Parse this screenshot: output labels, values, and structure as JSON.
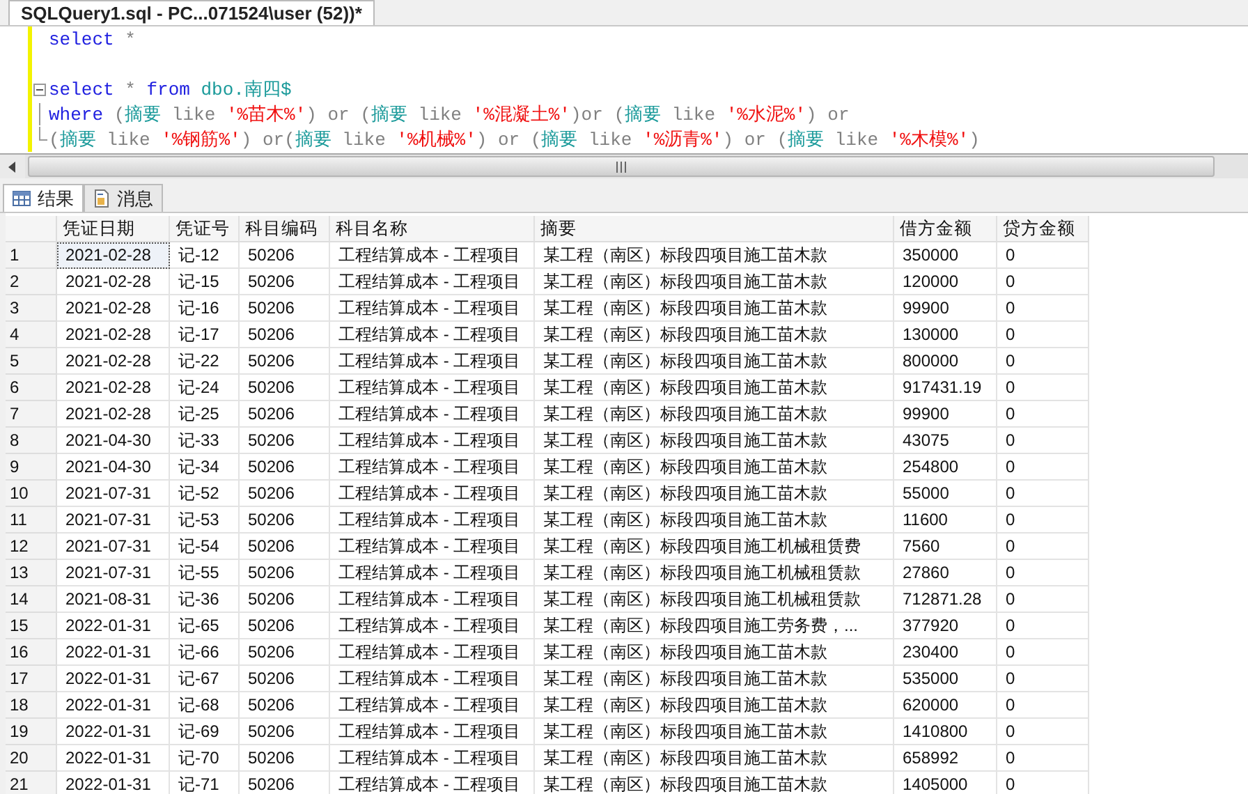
{
  "document_tab": {
    "title": "SQLQuery1.sql - PC...071524\\user (52))*",
    "selected": true
  },
  "editor": {
    "lines": [
      {
        "kind": "code",
        "tokens": [
          {
            "kind": "kw",
            "text": "select"
          },
          {
            "kind": "op",
            "text": " *"
          }
        ]
      },
      {
        "kind": "blank"
      },
      {
        "kind": "fold-start",
        "tokens": [
          {
            "kind": "kw",
            "text": "select"
          },
          {
            "kind": "op",
            "text": " * "
          },
          {
            "kind": "kw",
            "text": "from "
          },
          {
            "kind": "id",
            "text": "dbo.南四$"
          }
        ]
      },
      {
        "kind": "fold-mid",
        "tokens": [
          {
            "kind": "kw",
            "text": "where"
          },
          {
            "kind": "op",
            "text": " ("
          },
          {
            "kind": "id",
            "text": "摘要"
          },
          {
            "kind": "op",
            "text": " like "
          },
          {
            "kind": "str",
            "text": "'%苗木%'"
          },
          {
            "kind": "op",
            "text": ") or ("
          },
          {
            "kind": "id",
            "text": "摘要"
          },
          {
            "kind": "op",
            "text": " like "
          },
          {
            "kind": "str",
            "text": "'%混凝土%'"
          },
          {
            "kind": "op",
            "text": ")or ("
          },
          {
            "kind": "id",
            "text": "摘要"
          },
          {
            "kind": "op",
            "text": " like "
          },
          {
            "kind": "str",
            "text": "'%水泥%'"
          },
          {
            "kind": "op",
            "text": ") or"
          }
        ]
      },
      {
        "kind": "fold-end",
        "tokens": [
          {
            "kind": "op",
            "text": "("
          },
          {
            "kind": "id",
            "text": "摘要"
          },
          {
            "kind": "op",
            "text": " like "
          },
          {
            "kind": "str",
            "text": "'%钢筋%'"
          },
          {
            "kind": "op",
            "text": ") or("
          },
          {
            "kind": "id",
            "text": "摘要"
          },
          {
            "kind": "op",
            "text": " like "
          },
          {
            "kind": "str",
            "text": "'%机械%'"
          },
          {
            "kind": "op",
            "text": ") or ("
          },
          {
            "kind": "id",
            "text": "摘要"
          },
          {
            "kind": "op",
            "text": " like "
          },
          {
            "kind": "str",
            "text": "'%沥青%'"
          },
          {
            "kind": "op",
            "text": ") or ("
          },
          {
            "kind": "id",
            "text": "摘要"
          },
          {
            "kind": "op",
            "text": " like "
          },
          {
            "kind": "str",
            "text": "'%木模%'"
          },
          {
            "kind": "op",
            "text": ")"
          }
        ]
      }
    ]
  },
  "result_tabs": [
    {
      "label": "结果",
      "kind": "grid",
      "selected": true
    },
    {
      "label": "消息",
      "kind": "messages",
      "selected": false
    }
  ],
  "table": {
    "columns": [
      "凭证日期",
      "凭证号",
      "科目编码",
      "科目名称",
      "摘要",
      "借方金额",
      "贷方金额"
    ],
    "rows": [
      {
        "number": "1",
        "focused": true,
        "cells": [
          "2021-02-28",
          "记-12",
          "50206",
          "工程结算成本 - 工程项目",
          "某工程（南区）标段四项目施工苗木款",
          "350000",
          "0"
        ]
      },
      {
        "number": "2",
        "focused": false,
        "cells": [
          "2021-02-28",
          "记-15",
          "50206",
          "工程结算成本 - 工程项目",
          "某工程（南区）标段四项目施工苗木款",
          "120000",
          "0"
        ]
      },
      {
        "number": "3",
        "focused": false,
        "cells": [
          "2021-02-28",
          "记-16",
          "50206",
          "工程结算成本 - 工程项目",
          "某工程（南区）标段四项目施工苗木款",
          "99900",
          "0"
        ]
      },
      {
        "number": "4",
        "focused": false,
        "cells": [
          "2021-02-28",
          "记-17",
          "50206",
          "工程结算成本 - 工程项目",
          "某工程（南区）标段四项目施工苗木款",
          "130000",
          "0"
        ]
      },
      {
        "number": "5",
        "focused": false,
        "cells": [
          "2021-02-28",
          "记-22",
          "50206",
          "工程结算成本 - 工程项目",
          "某工程（南区）标段四项目施工苗木款",
          "800000",
          "0"
        ]
      },
      {
        "number": "6",
        "focused": false,
        "cells": [
          "2021-02-28",
          "记-24",
          "50206",
          "工程结算成本 - 工程项目",
          "某工程（南区）标段四项目施工苗木款",
          "917431.19",
          "0"
        ]
      },
      {
        "number": "7",
        "focused": false,
        "cells": [
          "2021-02-28",
          "记-25",
          "50206",
          "工程结算成本 - 工程项目",
          "某工程（南区）标段四项目施工苗木款",
          "99900",
          "0"
        ]
      },
      {
        "number": "8",
        "focused": false,
        "cells": [
          "2021-04-30",
          "记-33",
          "50206",
          "工程结算成本 - 工程项目",
          "某工程（南区）标段四项目施工苗木款",
          "43075",
          "0"
        ]
      },
      {
        "number": "9",
        "focused": false,
        "cells": [
          "2021-04-30",
          "记-34",
          "50206",
          "工程结算成本 - 工程项目",
          "某工程（南区）标段四项目施工苗木款",
          "254800",
          "0"
        ]
      },
      {
        "number": "10",
        "focused": false,
        "cells": [
          "2021-07-31",
          "记-52",
          "50206",
          "工程结算成本 - 工程项目",
          "某工程（南区）标段四项目施工苗木款",
          "55000",
          "0"
        ]
      },
      {
        "number": "11",
        "focused": false,
        "cells": [
          "2021-07-31",
          "记-53",
          "50206",
          "工程结算成本 - 工程项目",
          "某工程（南区）标段四项目施工苗木款",
          "11600",
          "0"
        ]
      },
      {
        "number": "12",
        "focused": false,
        "cells": [
          "2021-07-31",
          "记-54",
          "50206",
          "工程结算成本 - 工程项目",
          "某工程（南区）标段四项目施工机械租赁费",
          "7560",
          "0"
        ]
      },
      {
        "number": "13",
        "focused": false,
        "cells": [
          "2021-07-31",
          "记-55",
          "50206",
          "工程结算成本 - 工程项目",
          "某工程（南区）标段四项目施工机械租赁款",
          "27860",
          "0"
        ]
      },
      {
        "number": "14",
        "focused": false,
        "cells": [
          "2021-08-31",
          "记-36",
          "50206",
          "工程结算成本 - 工程项目",
          "某工程（南区）标段四项目施工机械租赁款",
          "712871.28",
          "0"
        ]
      },
      {
        "number": "15",
        "focused": false,
        "cells": [
          "2022-01-31",
          "记-65",
          "50206",
          "工程结算成本 - 工程项目",
          "某工程（南区）标段四项目施工劳务费，...",
          "377920",
          "0"
        ]
      },
      {
        "number": "16",
        "focused": false,
        "cells": [
          "2022-01-31",
          "记-66",
          "50206",
          "工程结算成本 - 工程项目",
          "某工程（南区）标段四项目施工苗木款",
          "230400",
          "0"
        ]
      },
      {
        "number": "17",
        "focused": false,
        "cells": [
          "2022-01-31",
          "记-67",
          "50206",
          "工程结算成本 - 工程项目",
          "某工程（南区）标段四项目施工苗木款",
          "535000",
          "0"
        ]
      },
      {
        "number": "18",
        "focused": false,
        "cells": [
          "2022-01-31",
          "记-68",
          "50206",
          "工程结算成本 - 工程项目",
          "某工程（南区）标段四项目施工苗木款",
          "620000",
          "0"
        ]
      },
      {
        "number": "19",
        "focused": false,
        "cells": [
          "2022-01-31",
          "记-69",
          "50206",
          "工程结算成本 - 工程项目",
          "某工程（南区）标段四项目施工苗木款",
          "1410800",
          "0"
        ]
      },
      {
        "number": "20",
        "focused": false,
        "cells": [
          "2022-01-31",
          "记-70",
          "50206",
          "工程结算成本 - 工程项目",
          "某工程（南区）标段四项目施工苗木款",
          "658992",
          "0"
        ]
      },
      {
        "number": "21",
        "focused": false,
        "cells": [
          "2022-01-31",
          "记-71",
          "50206",
          "工程结算成本 - 工程项目",
          "某工程（南区）标段四项目施工苗木款",
          "1405000",
          "0"
        ]
      }
    ]
  }
}
